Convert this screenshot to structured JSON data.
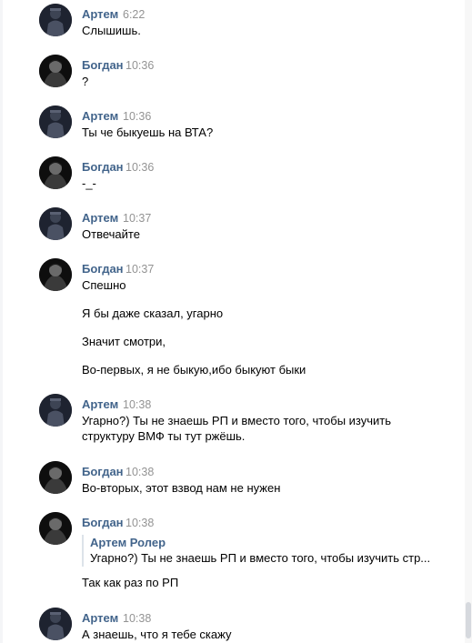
{
  "messages": [
    {
      "author": "Артем",
      "time": "6:22",
      "avatar": "artem",
      "lines": [
        "Слышишь."
      ]
    },
    {
      "author": "Богдан",
      "time": "10:36",
      "avatar": "bogdan",
      "lines": [
        "?"
      ]
    },
    {
      "author": "Артем",
      "time": "10:36",
      "avatar": "artem",
      "lines": [
        "Ты че быкуешь на ВТА?"
      ]
    },
    {
      "author": "Богдан",
      "time": "10:36",
      "avatar": "bogdan",
      "lines": [
        "-_-"
      ]
    },
    {
      "author": "Артем",
      "time": "10:37",
      "avatar": "artem",
      "lines": [
        "Отвечайте"
      ]
    },
    {
      "author": "Богдан",
      "time": "10:37",
      "avatar": "bogdan",
      "lines": [
        "Спешно",
        "Я бы даже сказал, угарно",
        "Значит смотри,",
        "Во-первых, я не быкую,ибо быкуют быки"
      ]
    },
    {
      "author": "Артем",
      "time": "10:38",
      "avatar": "artem",
      "lines": [
        "Угарно?) Ты не знаешь РП и вместо того, чтобы изучить",
        "структуру ВМФ ты тут ржёшь."
      ]
    },
    {
      "author": "Богдан",
      "time": "10:38",
      "avatar": "bogdan",
      "lines": [
        "Во-вторых, этот взвод нам не нужен"
      ]
    },
    {
      "author": "Богдан",
      "time": "10:38",
      "avatar": "bogdan",
      "quote": {
        "author": "Артем Ролер",
        "text": "Угарно?) Ты не знаешь РП и вместо того, чтобы изучить стр..."
      },
      "lines": [
        "Так как раз по РП"
      ]
    },
    {
      "author": "Артем",
      "time": "10:38",
      "avatar": "artem",
      "lines": [
        "А знаешь, что я тебе скажу"
      ]
    }
  ],
  "colors": {
    "author": "#42648b",
    "time": "#939393",
    "text": "#000000",
    "quote_border": "#dde3ea"
  },
  "icons": {
    "artem_avatar": "dark-figure-avatar-icon",
    "bogdan_avatar": "dark-portrait-avatar-icon"
  }
}
